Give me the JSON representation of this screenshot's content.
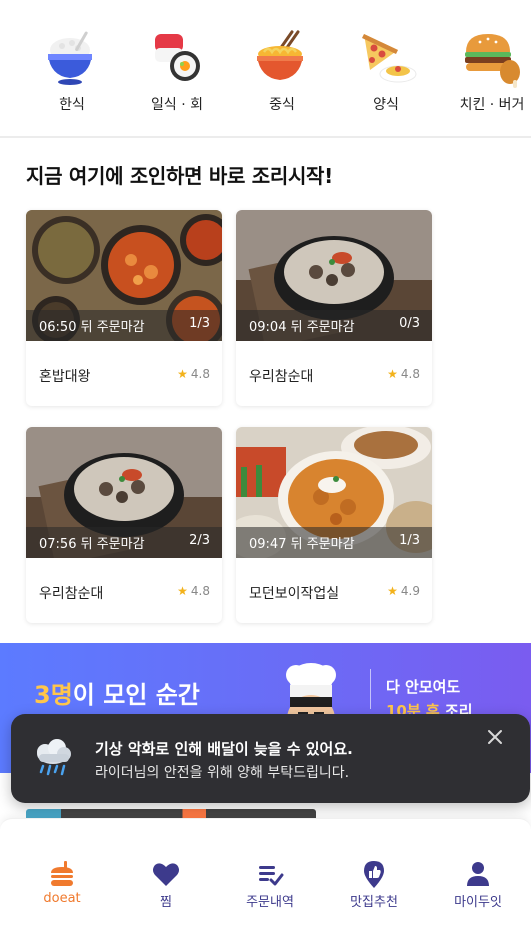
{
  "categories": [
    {
      "label": "한식",
      "icon": "rice-bowl-icon"
    },
    {
      "label": "일식 · 회",
      "icon": "sushi-icon"
    },
    {
      "label": "중식",
      "icon": "noodle-bowl-icon"
    },
    {
      "label": "양식",
      "icon": "pizza-pasta-icon"
    },
    {
      "label": "치킨 · 버거",
      "icon": "burger-chicken-icon"
    }
  ],
  "section_title": "지금 여기에 조인하면 바로 조리시작!",
  "cards": [
    {
      "deadline": "06:50 뒤 주문마감",
      "count": "1/3",
      "name": "혼밥대왕",
      "rating": "4.8"
    },
    {
      "deadline": "09:04 뒤 주문마감",
      "count": "0/3",
      "name": "우리참순대",
      "rating": "4.8"
    },
    {
      "deadline": "07:56 뒤 주문마감",
      "count": "2/3",
      "name": "우리참순대",
      "rating": "4.8"
    },
    {
      "deadline": "09:47 뒤 주문마감",
      "count": "1/3",
      "name": "모던보이작업실",
      "rating": "4.9"
    }
  ],
  "banner": {
    "left_highlight": "3명",
    "left_text": "이 모인 순간",
    "right_line1": "다 안모여도",
    "right_highlight": "10분 후",
    "right_line2_rest": " 조리"
  },
  "toast": {
    "title": "기상 악화로 인해 배달이 늦을 수 있어요.",
    "body": "라이더님의 안전을 위해 양해 부탁드립니다.",
    "icon": "rain-cloud-icon"
  },
  "nav": [
    {
      "label": "doeat",
      "icon": "doeat-logo-icon",
      "active": true
    },
    {
      "label": "찜",
      "icon": "heart-icon",
      "active": false
    },
    {
      "label": "주문내역",
      "icon": "order-list-icon",
      "active": false
    },
    {
      "label": "맛집추천",
      "icon": "thumb-pin-icon",
      "active": false
    },
    {
      "label": "마이두잇",
      "icon": "person-icon",
      "active": false
    }
  ],
  "colors": {
    "accent_orange": "#f07a2e",
    "nav_purple": "#3d3a8c",
    "star": "#f3b21b",
    "banner_blue": "#5c7bff",
    "toast_bg": "#2f2f33"
  }
}
